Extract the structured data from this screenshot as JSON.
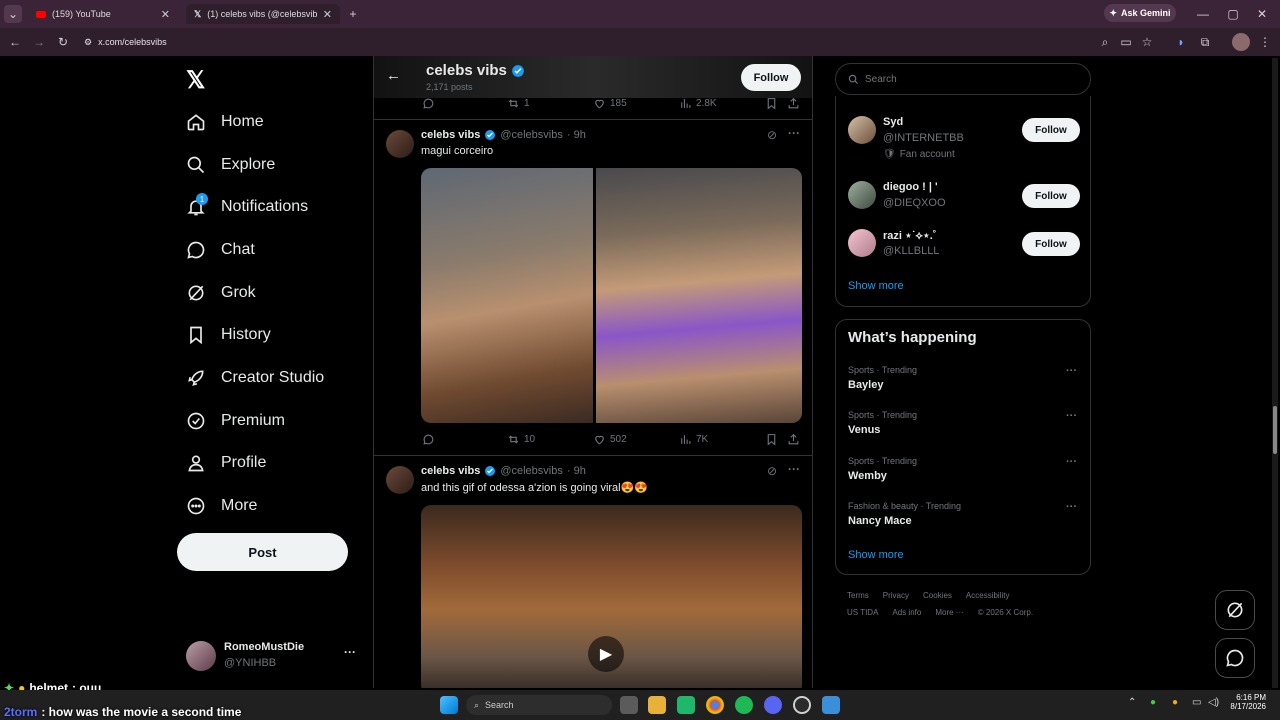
{
  "browser": {
    "tabs": [
      {
        "title": "(159) YouTube",
        "close": "✕"
      },
      {
        "title": "(1) celebs vibs (@celebsvibs) / X",
        "close": "✕"
      }
    ],
    "new_tab": "+",
    "ask_gemini": "Ask Gemini",
    "url": "x.com/celebsvibs",
    "window_controls": [
      "—",
      "▢",
      "✕"
    ]
  },
  "nav": {
    "items": [
      {
        "label": "Home",
        "icon": "home-icon"
      },
      {
        "label": "Explore",
        "icon": "search-icon"
      },
      {
        "label": "Notifications",
        "icon": "bell-icon",
        "badge": "1"
      },
      {
        "label": "Chat",
        "icon": "chat-icon"
      },
      {
        "label": "Grok",
        "icon": "grok-icon"
      },
      {
        "label": "History",
        "icon": "bookmark-icon"
      },
      {
        "label": "Creator Studio",
        "icon": "rocket-icon"
      },
      {
        "label": "Premium",
        "icon": "verified-icon"
      },
      {
        "label": "Profile",
        "icon": "person-icon"
      },
      {
        "label": "More",
        "icon": "more-circle-icon"
      }
    ],
    "post_label": "Post",
    "account": {
      "name": "RomeoMustDie",
      "handle": "@YNIHBB",
      "menu": "···"
    }
  },
  "profile_header": {
    "name": "celebs vibs",
    "posts": "2,171 posts",
    "follow_label": "Follow"
  },
  "top_actions": {
    "replies": "",
    "reposts": "1",
    "likes": "185",
    "views": "2.8K"
  },
  "tweets": [
    {
      "author": "celebs vibs",
      "handle": "@celebsvibs",
      "time": "· 9h",
      "text": "magui corceiro",
      "actions": {
        "replies": "",
        "reposts": "10",
        "likes": "502",
        "views": "7K"
      }
    },
    {
      "author": "celebs vibs",
      "handle": "@celebsvibs",
      "time": "· 9h",
      "text": "and this gif of odessa a'zion is going viral😍😍"
    }
  ],
  "search": {
    "placeholder": "Search"
  },
  "who_to_follow": {
    "accounts": [
      {
        "name": "Syd",
        "handle": "@INTERNETBB",
        "extra": "Fan account",
        "follow": "Follow"
      },
      {
        "name": "diegoo ! | '",
        "handle": "@DIEQXOO",
        "follow": "Follow"
      },
      {
        "name": "razi ⋆˙⟡⋆.˚",
        "handle": "@KLLBLLL",
        "follow": "Follow"
      }
    ],
    "show_more": "Show more"
  },
  "whats_happening": {
    "title": "What’s happening",
    "trends": [
      {
        "meta": "Sports · Trending",
        "name": "Bayley"
      },
      {
        "meta": "Sports · Trending",
        "name": "Venus"
      },
      {
        "meta": "Sports · Trending",
        "name": "Wemby"
      },
      {
        "meta": "Fashion & beauty · Trending",
        "name": "Nancy Mace"
      }
    ],
    "show_more": "Show more"
  },
  "footer": {
    "row1": [
      "Terms",
      "Privacy",
      "Cookies",
      "Accessibility"
    ],
    "row2": [
      "US TIDA",
      "Ads info",
      "More ···",
      "© 2026 X Corp."
    ]
  },
  "overlay_chat": [
    {
      "user": "helmet",
      "text": ": ouu"
    },
    {
      "user": "2torm",
      "text": ": how was the movie a second time"
    }
  ],
  "taskbar": {
    "search_placeholder": "Search",
    "time": "6:16 PM",
    "date": "8/17/2026"
  },
  "colors": {
    "accent": "#1d9bf0",
    "chrome_tab": "#3c2438",
    "background": "#000000"
  }
}
